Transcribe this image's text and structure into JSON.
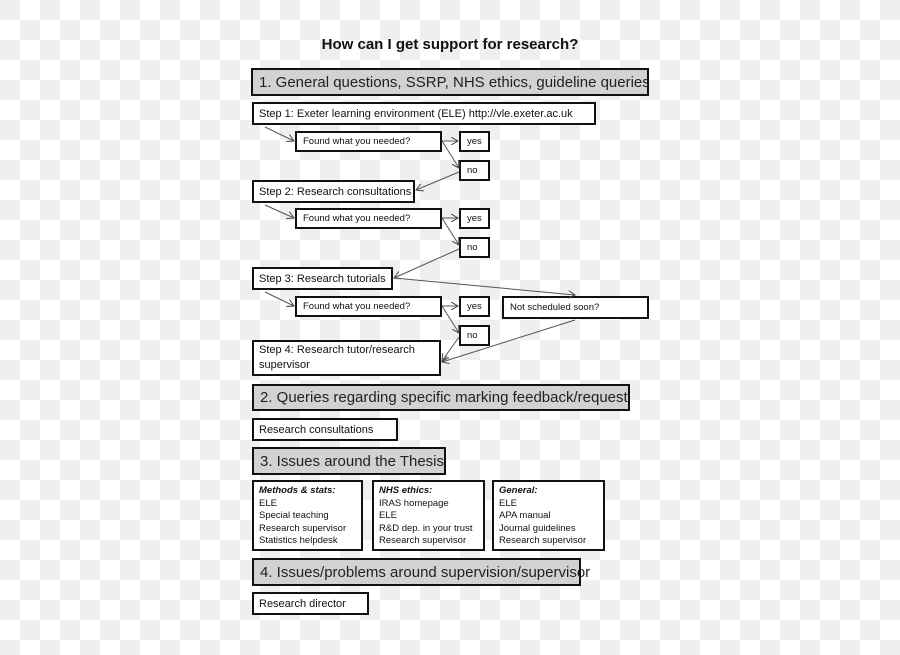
{
  "title": "How can I get support for research?",
  "sections": {
    "s1": {
      "header": "1. General questions, SSRP, NHS ethics, guideline queries"
    },
    "s2": {
      "header": "2. Queries regarding specific marking feedback/request",
      "box": "Research consultations"
    },
    "s3": {
      "header": "3. Issues around the Thesis"
    },
    "s4": {
      "header": "4. Issues/problems around supervision/supervisor",
      "box": "Research director"
    }
  },
  "flow": {
    "step1": "Step 1: Exeter learning environment (ELE) http://vle.exeter.ac.uk",
    "step2": "Step 2: Research consultations",
    "step3": "Step 3: Research tutorials",
    "step4_line1": "Step 4: Research tutor/research",
    "step4_line2": "supervisor",
    "question": "Found what you needed?",
    "yes": "yes",
    "no": "no",
    "not_scheduled": "Not scheduled soon?"
  },
  "thesis_lists": [
    {
      "heading": "Methods & stats:",
      "items": [
        "ELE",
        "Special teaching",
        "Research supervisor",
        "Statistics helpdesk"
      ]
    },
    {
      "heading": "NHS ethics:",
      "items": [
        "IRAS homepage",
        "ELE",
        "R&D dep. in your trust",
        "Research supervisor"
      ]
    },
    {
      "heading": "General:",
      "items": [
        "ELE",
        "APA manual",
        "Journal guidelines",
        "Research supervisor"
      ]
    }
  ]
}
